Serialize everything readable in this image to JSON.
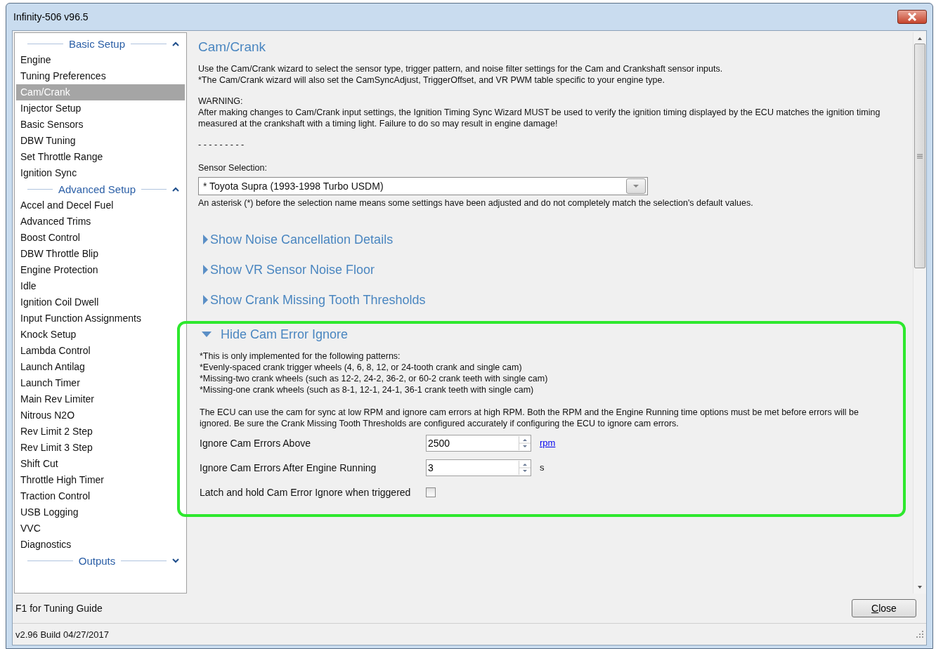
{
  "window": {
    "title": "Infinity-506 v96.5"
  },
  "sidebar": {
    "groups": [
      {
        "title": "Basic Setup",
        "expanded": true,
        "items": [
          {
            "label": "Engine",
            "selected": false
          },
          {
            "label": "Tuning Preferences",
            "selected": false
          },
          {
            "label": "Cam/Crank",
            "selected": true
          },
          {
            "label": "Injector Setup",
            "selected": false
          },
          {
            "label": "Basic Sensors",
            "selected": false
          },
          {
            "label": "DBW Tuning",
            "selected": false
          },
          {
            "label": "Set Throttle Range",
            "selected": false
          },
          {
            "label": "Ignition Sync",
            "selected": false
          }
        ]
      },
      {
        "title": "Advanced Setup",
        "expanded": true,
        "items": [
          {
            "label": "Accel and Decel Fuel",
            "selected": false
          },
          {
            "label": "Advanced Trims",
            "selected": false
          },
          {
            "label": "Boost Control",
            "selected": false
          },
          {
            "label": "DBW Throttle Blip",
            "selected": false
          },
          {
            "label": "Engine Protection",
            "selected": false
          },
          {
            "label": "Idle",
            "selected": false
          },
          {
            "label": "Ignition Coil Dwell",
            "selected": false
          },
          {
            "label": "Input Function Assignments",
            "selected": false
          },
          {
            "label": "Knock Setup",
            "selected": false
          },
          {
            "label": "Lambda Control",
            "selected": false
          },
          {
            "label": "Launch Antilag",
            "selected": false
          },
          {
            "label": "Launch Timer",
            "selected": false
          },
          {
            "label": "Main Rev Limiter",
            "selected": false
          },
          {
            "label": "Nitrous N2O",
            "selected": false
          },
          {
            "label": "Rev Limit 2 Step",
            "selected": false
          },
          {
            "label": "Rev Limit 3 Step",
            "selected": false
          },
          {
            "label": "Shift Cut",
            "selected": false
          },
          {
            "label": "Throttle High Timer",
            "selected": false
          },
          {
            "label": "Traction Control",
            "selected": false
          },
          {
            "label": "USB Logging",
            "selected": false
          },
          {
            "label": "VVC",
            "selected": false
          },
          {
            "label": "Diagnostics",
            "selected": false
          }
        ]
      },
      {
        "title": "Outputs",
        "expanded": false
      }
    ]
  },
  "content": {
    "title": "Cam/Crank",
    "intro": [
      "Use the Cam/Crank wizard to select the sensor type, trigger pattern, and noise filter settings for the Cam and Crankshaft sensor inputs.",
      "*The Cam/Crank wizard will also set the CamSyncAdjust, TriggerOffset, and VR PWM table specific to your engine type."
    ],
    "warning_title": "WARNING:",
    "warning": "After making changes to Cam/Crank input settings, the Ignition Timing Sync Wizard MUST be used to verify the ignition timing displayed by the ECU matches the ignition timing measured at the crankshaft with a timing light. Failure to do so may result in engine damage!",
    "separator": "- - - - - - - - -",
    "sensor_label": "Sensor Selection:",
    "sensor_value": "* Toyota Supra (1993-1998 Turbo USDM)",
    "sensor_note": "An asterisk (*) before the selection name means some settings have been adjusted and do not completely match the selection's default values.",
    "sections": [
      {
        "title": "Show Noise Cancellation Details",
        "expanded": false,
        "highlighted": false
      },
      {
        "title": "Show VR Sensor Noise Floor",
        "expanded": false,
        "highlighted": false
      },
      {
        "title": "Show Crank Missing Tooth Thresholds",
        "expanded": false,
        "highlighted": false
      },
      {
        "title": "Hide Cam Error Ignore",
        "expanded": true,
        "highlighted": true,
        "notes": [
          "*This is only implemented for the following patterns:",
          "*Evenly-spaced crank trigger wheels (4, 6, 8, 12, or 24-tooth crank and single cam)",
          "*Missing-two crank wheels (such as 12-2, 24-2, 36-2, or 60-2 crank teeth with single cam)",
          "*Missing-one crank wheels (such as 8-1, 12-1, 24-1, 36-1 crank teeth with single cam)"
        ],
        "description": "The ECU can use the cam for sync at low RPM and ignore cam errors at high RPM. Both the RPM and the Engine Running time options must be met before errors will be ignored. Be sure the Crank Missing Tooth Thresholds are configured accurately if configuring the ECU to ignore cam errors.",
        "fields": [
          {
            "kind": "spinner",
            "label": "Ignore Cam Errors Above",
            "value": "2500",
            "unit": "rpm",
            "unit_link": true
          },
          {
            "kind": "spinner",
            "label": "Ignore Cam Errors After Engine Running",
            "value": "3",
            "unit": "s",
            "unit_link": false
          },
          {
            "kind": "checkbox",
            "label": "Latch and hold Cam Error Ignore when triggered",
            "checked": false
          }
        ]
      }
    ]
  },
  "footer": {
    "hint": "F1 for Tuning Guide",
    "button": "Close"
  },
  "status_bar": {
    "text": "v2.96 Build 04/27/2017"
  }
}
